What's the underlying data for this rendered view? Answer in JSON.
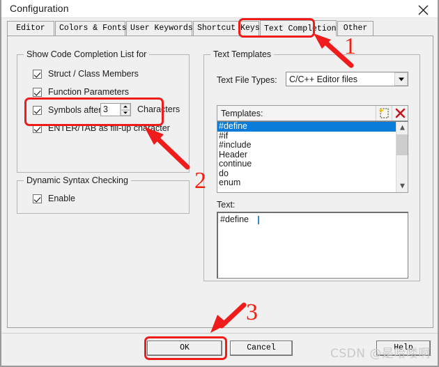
{
  "window": {
    "title": "Configuration",
    "close_icon": "close-icon"
  },
  "tabs": [
    {
      "label": "Editor",
      "active": false
    },
    {
      "label": "Colors & Fonts",
      "active": false
    },
    {
      "label": "User Keywords",
      "active": false
    },
    {
      "label": "Shortcut Keys",
      "active": false
    },
    {
      "label": "Text Completion",
      "active": true
    },
    {
      "label": "Other",
      "active": false
    }
  ],
  "left_panel": {
    "completion_group": {
      "legend": "Show Code Completion List for",
      "items": [
        {
          "label": "Struct / Class Members",
          "checked": true
        },
        {
          "label": "Function Parameters",
          "checked": true
        }
      ],
      "symbols_after": {
        "label": "Symbols after",
        "checked": true,
        "value": "3",
        "suffix": "Characters"
      },
      "enter_tab": {
        "label": "ENTER/TAB as fill-up character",
        "checked": true
      }
    },
    "syntax_group": {
      "legend": "Dynamic Syntax Checking",
      "enable": {
        "label": "Enable",
        "checked": true
      }
    }
  },
  "right_panel": {
    "legend": "Text Templates",
    "file_types": {
      "label": "Text File Types:",
      "value": "C/C++ Editor files",
      "arrow_icon": "chevron-down-icon"
    },
    "templates": {
      "label": "Templates:",
      "new_icon": "new-template-icon",
      "delete_icon": "delete-template-icon",
      "items": [
        {
          "label": "#define",
          "selected": true
        },
        {
          "label": "#if",
          "selected": false
        },
        {
          "label": "#include",
          "selected": false
        },
        {
          "label": "Header",
          "selected": false
        },
        {
          "label": "continue",
          "selected": false
        },
        {
          "label": "do",
          "selected": false
        },
        {
          "label": "enum",
          "selected": false
        }
      ],
      "scroll_up_icon": "chevron-up-icon",
      "scroll_down_icon": "chevron-down-icon"
    },
    "text_area": {
      "label": "Text:",
      "value": "#define "
    }
  },
  "buttons": {
    "ok": "OK",
    "cancel": "Cancel",
    "help": "Help"
  },
  "annotations": {
    "marker_1": "1",
    "marker_2": "2",
    "marker_3": "3"
  },
  "watermark": {
    "text": "CSDN @是哈喽啊"
  }
}
